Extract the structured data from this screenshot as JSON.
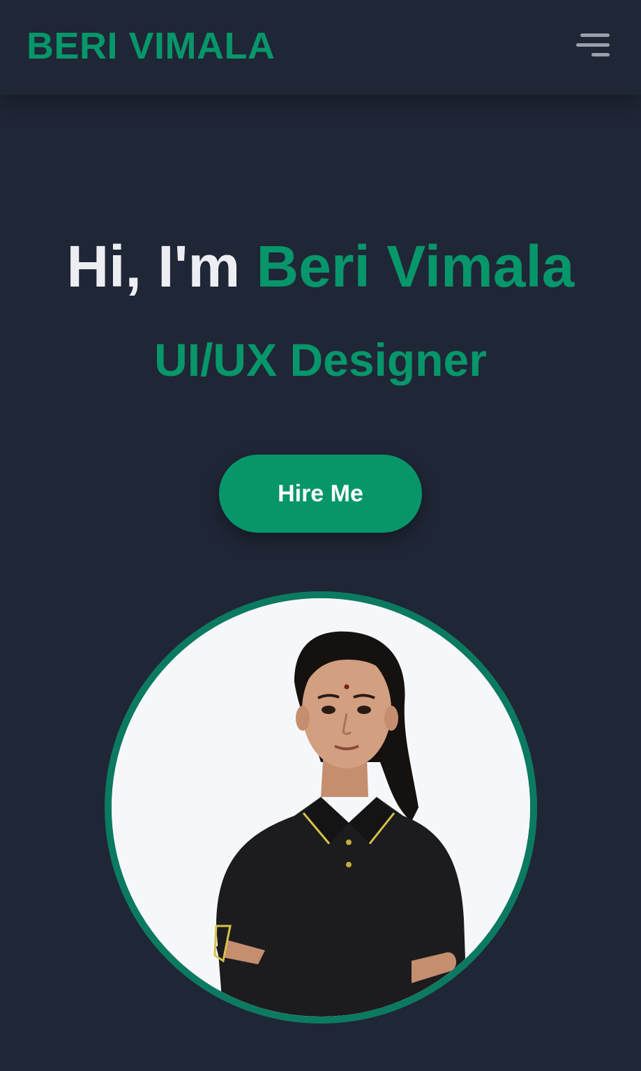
{
  "navbar": {
    "brand": "BERI VIMALA",
    "menu_icon": "hamburger-menu-icon"
  },
  "hero": {
    "greeting": "Hi, I'm ",
    "name": "Beri Vimala",
    "role": "UI/UX Designer",
    "cta_label": "Hire Me"
  },
  "profile_photo": {
    "alt": "Portrait of Beri Vimala"
  },
  "colors": {
    "background": "#1f2636",
    "accent": "#07966a",
    "photo_ring": "#0b7a60",
    "heading_text": "#eceef2"
  }
}
